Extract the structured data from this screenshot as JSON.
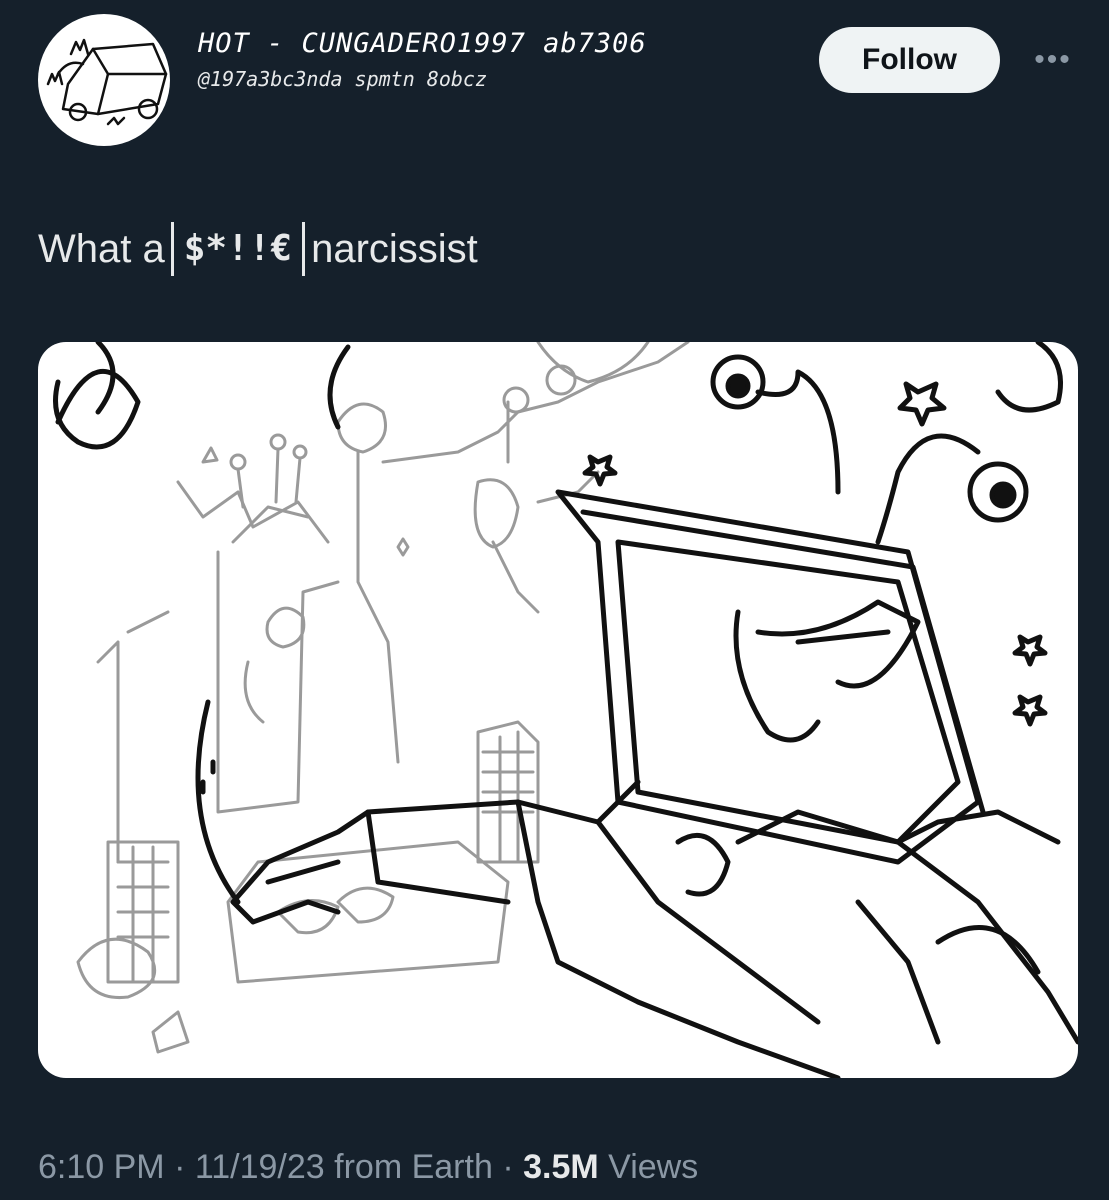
{
  "author": {
    "display_name": "HOT - CUNGADERO1997 ab7306",
    "handle": "@197a3bc3nda spmtn 8obcz"
  },
  "actions": {
    "follow_label": "Follow",
    "more_label": "•••",
    "more_icon": "more-horizontal-icon"
  },
  "post": {
    "text_before": "What a",
    "censored_word": "$*!!€",
    "text_after": "narcissist"
  },
  "meta": {
    "time": "6:10 PM",
    "separator": "·",
    "date": "11/19/23",
    "source": "from Earth",
    "views_count": "3.5M",
    "views_label": "Views"
  },
  "colors": {
    "background": "#15202b",
    "text": "#e7e9ea",
    "secondary_text": "#8b98a5",
    "follow_button_bg": "#eff3f4"
  }
}
